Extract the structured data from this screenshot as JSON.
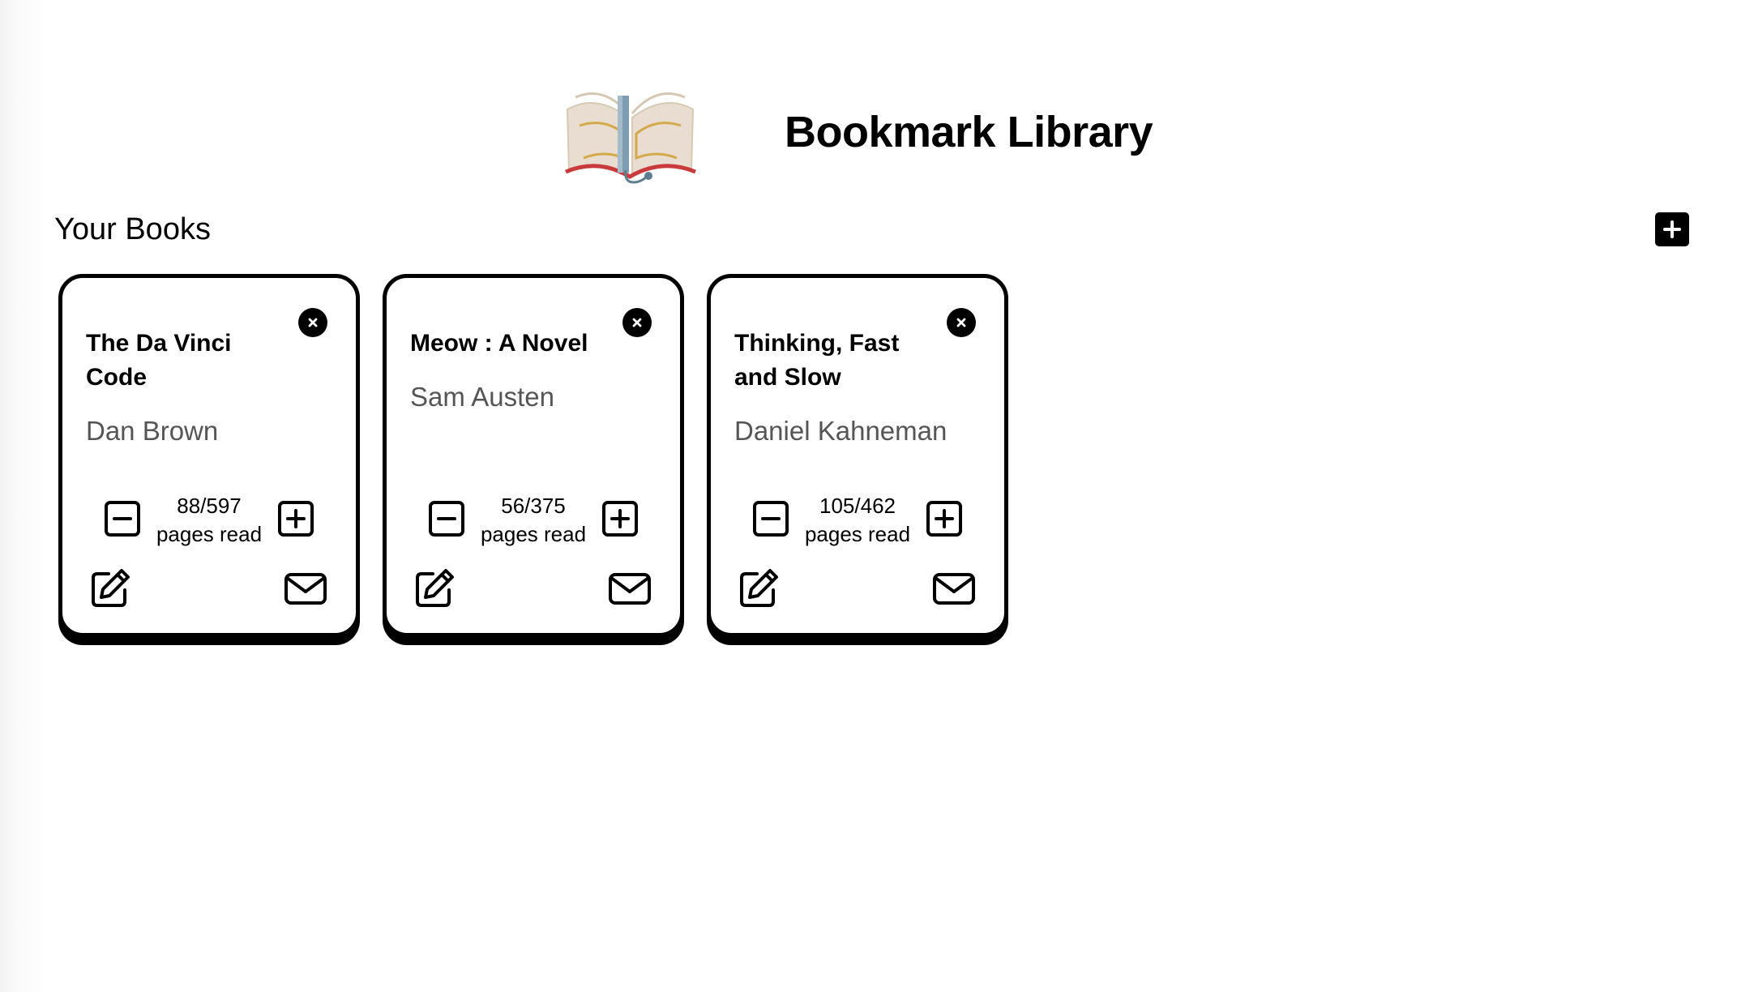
{
  "header": {
    "title": "Bookmark Library",
    "logo_icon": "open-book-logo"
  },
  "section": {
    "title": "Your Books",
    "add_icon": "plus-icon"
  },
  "books": [
    {
      "title": "The Da Vinci Code",
      "author": "Dan Brown",
      "progress": "88/597",
      "progress_label": "pages read",
      "pages_read": 88,
      "total_pages": 597
    },
    {
      "title": "Meow : A Novel",
      "author": "Sam Austen",
      "progress": "56/375",
      "progress_label": "pages read",
      "pages_read": 56,
      "total_pages": 375
    },
    {
      "title": "Thinking, Fast and Slow",
      "author": "Daniel Kahneman",
      "progress": "105/462",
      "progress_label": "pages read",
      "pages_read": 105,
      "total_pages": 462
    }
  ],
  "colors": {
    "primary": "#000000",
    "author_text": "#555555",
    "logo_page": "#e8ddd0",
    "logo_accent": "#d4a94a",
    "logo_ribbon": "#7f9db0",
    "logo_red": "#c93a3a"
  }
}
